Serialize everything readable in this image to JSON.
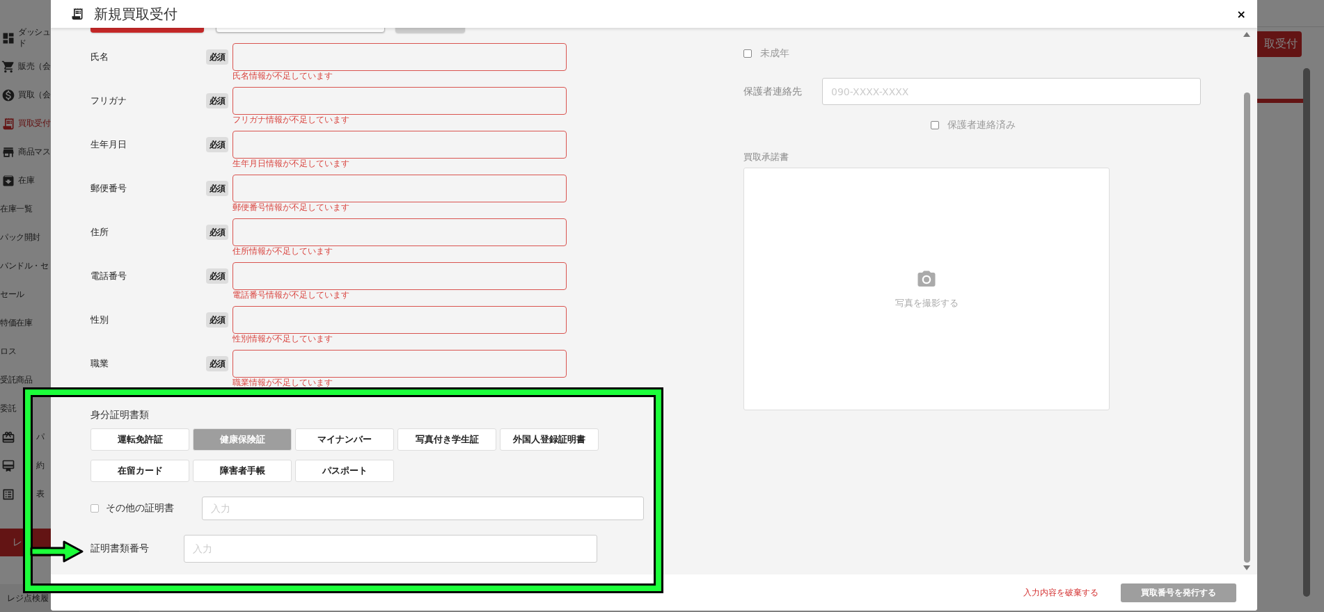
{
  "app": {
    "sidebar": {
      "items": [
        {
          "label": "ダッシュド",
          "selected": false
        },
        {
          "label": "販売（会",
          "selected": false
        },
        {
          "label": "買取（会",
          "selected": false
        },
        {
          "label": "買取受付",
          "selected": true
        },
        {
          "label": "商品マス",
          "selected": false
        },
        {
          "label": "在庫",
          "selected": false,
          "children": [
            {
              "label": "在庫一覧",
              "selected": false
            },
            {
              "label": "パック開封",
              "selected": false
            },
            {
              "label": "バンドル・セ",
              "selected": false
            },
            {
              "label": "セール",
              "selected": false
            },
            {
              "label": "特価在庫",
              "selected": false
            },
            {
              "label": "ロス",
              "selected": false
            },
            {
              "label": "受託商品",
              "selected": false
            },
            {
              "label": "委託",
              "selected": false
            }
          ]
        },
        {
          "label": "パ",
          "selected": false
        },
        {
          "label": "約",
          "selected": false
        },
        {
          "label": "表",
          "selected": false
        }
      ],
      "register_button": "レ",
      "bottom_link": "レジ点検履"
    },
    "header_button": "取受付"
  },
  "modal": {
    "title": "新規買取受付",
    "close": "×",
    "fields": [
      {
        "label": "氏名",
        "badge": "必須",
        "error": "氏名情報が不足しています"
      },
      {
        "label": "フリガナ",
        "badge": "必須",
        "error": "フリガナ情報が不足しています"
      },
      {
        "label": "生年月日",
        "badge": "必須",
        "error": "生年月日情報が不足しています"
      },
      {
        "label": "郵便番号",
        "badge": "必須",
        "error": "郵便番号情報が不足しています"
      },
      {
        "label": "住所",
        "badge": "必須",
        "error": "住所情報が不足しています"
      },
      {
        "label": "電話番号",
        "badge": "必須",
        "error": "電話番号情報が不足しています"
      },
      {
        "label": "性別",
        "badge": "必須",
        "error": "性別情報が不足しています"
      },
      {
        "label": "職業",
        "badge": "必須",
        "error": "職業情報が不足しています"
      }
    ],
    "id_section": {
      "title": "身分証明書類",
      "options": [
        {
          "label": "運転免許証",
          "selected": false
        },
        {
          "label": "健康保険証",
          "selected": true
        },
        {
          "label": "マイナンバー",
          "selected": false
        },
        {
          "label": "写真付き学生証",
          "selected": false
        },
        {
          "label": "外国人登録証明書",
          "selected": false
        },
        {
          "label": "在留カード",
          "selected": false
        },
        {
          "label": "障害者手帳",
          "selected": false
        },
        {
          "label": "パスポート",
          "selected": false
        }
      ],
      "other": {
        "label": "その他の証明書",
        "checked": false,
        "placeholder": "入力"
      },
      "number": {
        "label": "証明書類番号",
        "placeholder": "入力"
      }
    },
    "minor": {
      "label": "未成年",
      "checked": false
    },
    "guardian_contact": {
      "label": "保護者連絡先",
      "placeholder": "090-XXXX-XXXX"
    },
    "guardian_contacted": {
      "label": "保護者連絡済み",
      "checked": false
    },
    "consent": {
      "label": "買取承諾書",
      "action": "写真を撮影する"
    },
    "footer": {
      "discard": "入力内容を破棄する",
      "submit": "買取番号を発行する"
    }
  }
}
